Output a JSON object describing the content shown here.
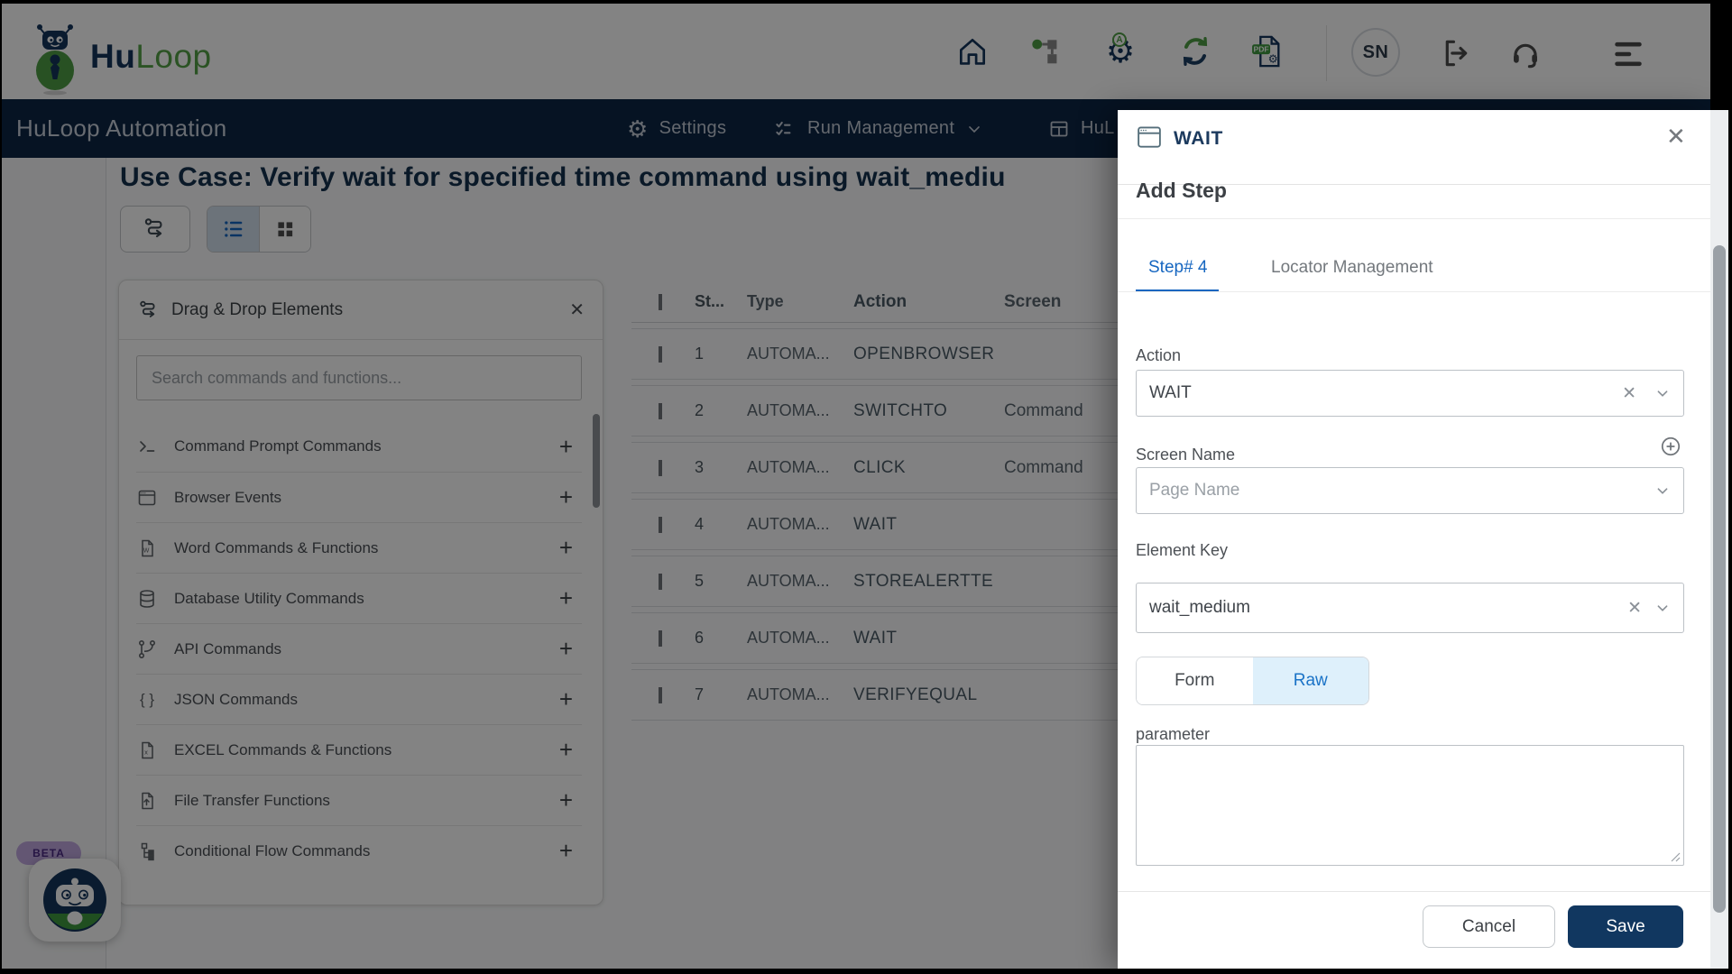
{
  "header": {
    "brand": {
      "hu": "Hu",
      "loop": "Loop"
    },
    "avatar_initials": "SN",
    "icons": [
      "home-icon",
      "workflow-icon",
      "automation-gear-icon",
      "sync-icon",
      "pdf-export-icon",
      "logout-icon",
      "support-headset-icon",
      "menu-icon"
    ]
  },
  "nav": {
    "app_title": "HuLoop Automation",
    "settings_label": "Settings",
    "run_management_label": "Run Management",
    "partial_item_label": "HuL"
  },
  "page": {
    "heading": "Use Case: Verify wait for specified time command using wait_mediu",
    "beta_badge": "BETA"
  },
  "drag_panel": {
    "title": "Drag & Drop Elements",
    "search_placeholder": "Search commands and functions...",
    "add_icon": "+",
    "items": [
      {
        "icon": "terminal-icon",
        "label": "Command Prompt Commands"
      },
      {
        "icon": "browser-window-icon",
        "label": "Browser Events"
      },
      {
        "icon": "word-doc-icon",
        "label": "Word Commands & Functions"
      },
      {
        "icon": "database-icon",
        "label": "Database Utility Commands"
      },
      {
        "icon": "api-branch-icon",
        "label": "API Commands"
      },
      {
        "icon": "json-braces-icon",
        "label": "JSON Commands"
      },
      {
        "icon": "excel-doc-icon",
        "label": "EXCEL Commands & Functions"
      },
      {
        "icon": "file-transfer-icon",
        "label": "File Transfer Functions"
      },
      {
        "icon": "conditional-flow-icon",
        "label": "Conditional Flow Commands"
      }
    ]
  },
  "steps_table": {
    "columns": {
      "step": "St...",
      "type": "Type",
      "action": "Action",
      "screen": "Screen"
    },
    "rows": [
      {
        "num": "1",
        "type": "AUTOMA...",
        "action": "OPENBROWSER",
        "screen": ""
      },
      {
        "num": "2",
        "type": "AUTOMA...",
        "action": "SWITCHTO",
        "screen": "Command"
      },
      {
        "num": "3",
        "type": "AUTOMA...",
        "action": "CLICK",
        "screen": "Command"
      },
      {
        "num": "4",
        "type": "AUTOMA...",
        "action": "WAIT",
        "screen": ""
      },
      {
        "num": "5",
        "type": "AUTOMA...",
        "action": "STOREALERTTE",
        "screen": ""
      },
      {
        "num": "6",
        "type": "AUTOMA...",
        "action": "WAIT",
        "screen": ""
      },
      {
        "num": "7",
        "type": "AUTOMA...",
        "action": "VERIFYEQUAL",
        "screen": ""
      }
    ]
  },
  "modal": {
    "title": "WAIT",
    "section_title": "Add Step",
    "tabs": [
      {
        "label": "Step# 4"
      },
      {
        "label": "Locator Management"
      }
    ],
    "fields": {
      "action": {
        "label": "Action",
        "value": "WAIT"
      },
      "screen_name": {
        "label": "Screen Name",
        "placeholder": "Page Name"
      },
      "element_key": {
        "label": "Element Key",
        "value": "wait_medium"
      }
    },
    "mode_toggle": {
      "form": "Form",
      "raw": "Raw",
      "active": "Raw"
    },
    "parameter": {
      "label": "parameter",
      "value": ""
    },
    "cancel_label": "Cancel",
    "save_label": "Save"
  },
  "glyphs": {
    "gear": "⚙",
    "close": "✕",
    "plus": "+",
    "braces": "{ }",
    "w": "W",
    "x": "x",
    "a": "A",
    "pdf": "PDF"
  },
  "colors": {
    "brand_navy": "#14355c",
    "brand_green": "#4f9e45",
    "nav_navy": "#0d2545",
    "tab_blue": "#1666c0",
    "raw_bg": "#def0fb",
    "save_navy": "#113760",
    "beta_purple": "#4b2a85"
  }
}
